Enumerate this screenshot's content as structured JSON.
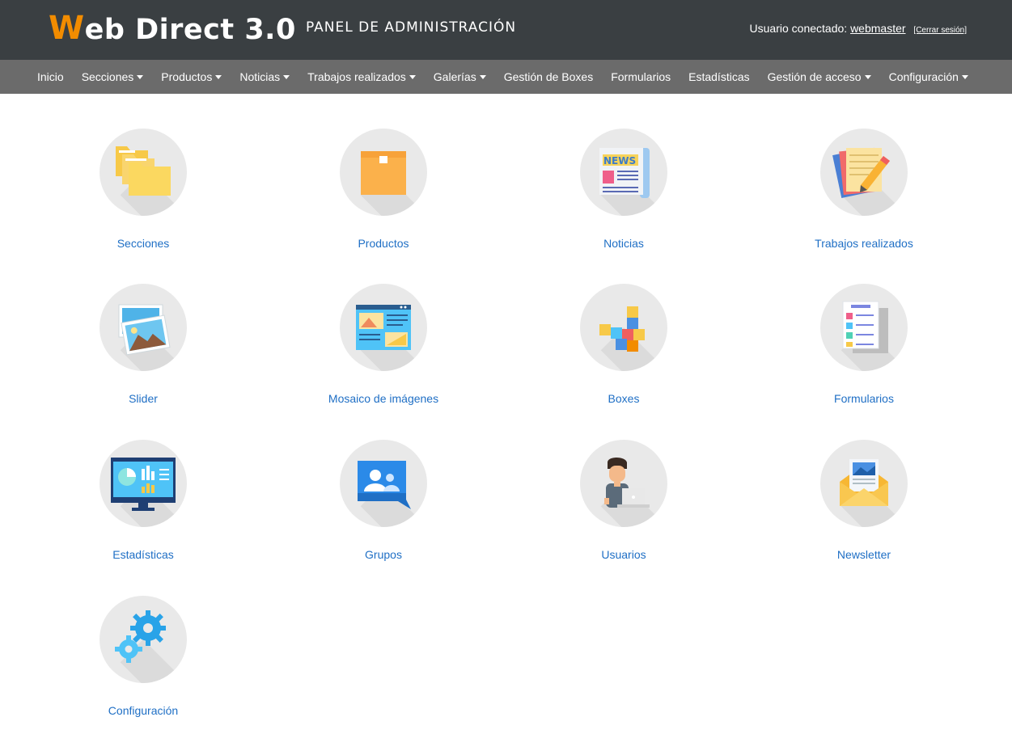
{
  "header": {
    "logo_w": "W",
    "logo_rest": "eb Direct 3.0",
    "panel_title": "PANEL DE ADMINISTRACIÓN",
    "user_prefix": "Usuario conectado:",
    "username": "webmaster",
    "logout": "[Cerrar sesión]",
    "brand_color": "#f28c00"
  },
  "nav": {
    "items": [
      {
        "label": "Inicio",
        "dropdown": false
      },
      {
        "label": "Secciones",
        "dropdown": true
      },
      {
        "label": "Productos",
        "dropdown": true
      },
      {
        "label": "Noticias",
        "dropdown": true
      },
      {
        "label": "Trabajos realizados",
        "dropdown": true
      },
      {
        "label": "Galerías",
        "dropdown": true
      },
      {
        "label": "Gestión de Boxes",
        "dropdown": false
      },
      {
        "label": "Formularios",
        "dropdown": false
      },
      {
        "label": "Estadísticas",
        "dropdown": false
      },
      {
        "label": "Gestión de acceso",
        "dropdown": true
      },
      {
        "label": "Configuración",
        "dropdown": true
      }
    ]
  },
  "tiles": [
    {
      "label": "Secciones",
      "icon": "folders-icon"
    },
    {
      "label": "Productos",
      "icon": "box-icon"
    },
    {
      "label": "Noticias",
      "icon": "newspaper-icon"
    },
    {
      "label": "Trabajos realizados",
      "icon": "notepad-pencil-icon"
    },
    {
      "label": "Slider",
      "icon": "photos-icon"
    },
    {
      "label": "Mosaico de imágenes",
      "icon": "web-layout-icon"
    },
    {
      "label": "Boxes",
      "icon": "cubes-icon"
    },
    {
      "label": "Formularios",
      "icon": "form-checklist-icon"
    },
    {
      "label": "Estadísticas",
      "icon": "monitor-chart-icon"
    },
    {
      "label": "Grupos",
      "icon": "group-chat-icon"
    },
    {
      "label": "Usuarios",
      "icon": "user-laptop-icon"
    },
    {
      "label": "Newsletter",
      "icon": "envelope-letter-icon"
    },
    {
      "label": "Configuración",
      "icon": "gears-icon"
    }
  ]
}
